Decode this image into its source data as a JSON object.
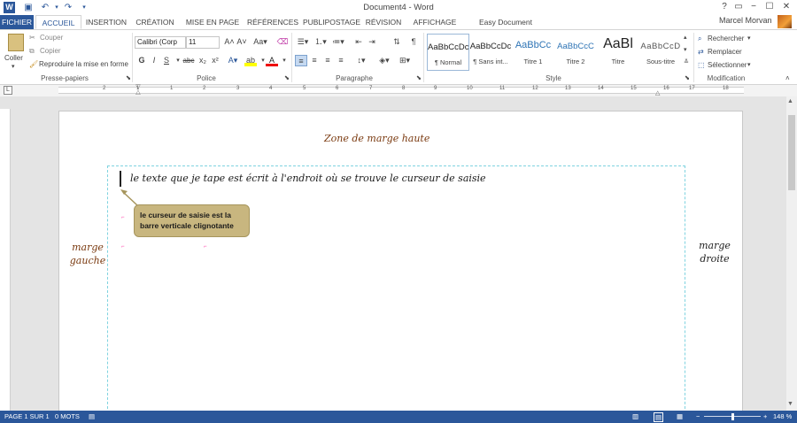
{
  "app": {
    "title": "Document4 - Word",
    "user": "Marcel Morvan",
    "help": "?"
  },
  "tabs": [
    "FICHIER",
    "ACCUEIL",
    "INSERTION",
    "CRÉATION",
    "MISE EN PAGE",
    "RÉFÉRENCES",
    "PUBLIPOSTAGE",
    "RÉVISION",
    "AFFICHAGE",
    "Easy Document Creator"
  ],
  "clipboard": {
    "paste": "Coller",
    "cut": "Couper",
    "copy": "Copier",
    "format_painter": "Reproduire la mise en forme",
    "label": "Presse-papiers"
  },
  "font": {
    "name": "Calibri (Corp",
    "size": "11",
    "bold": "G",
    "italic": "I",
    "underline": "S",
    "strike": "abc",
    "sub": "x₂",
    "sup": "x²",
    "label": "Police"
  },
  "paragraph": {
    "label": "Paragraphe"
  },
  "styles": {
    "label": "Style",
    "items": [
      {
        "preview": "AaBbCcDc",
        "name": "¶ Normal"
      },
      {
        "preview": "AaBbCcDc",
        "name": "¶ Sans int..."
      },
      {
        "preview": "AaBbCc",
        "name": "Titre 1"
      },
      {
        "preview": "AaBbCcC",
        "name": "Titre 2"
      },
      {
        "preview": "AaBl",
        "name": "Titre"
      },
      {
        "preview": "AaBbCcD",
        "name": "Sous-titre"
      }
    ]
  },
  "editing": {
    "find": "Rechercher",
    "replace": "Remplacer",
    "select": "Sélectionner",
    "label": "Modification"
  },
  "ruler_numbers": [
    "2",
    "1",
    "1",
    "2",
    "3",
    "4",
    "5",
    "6",
    "7",
    "8",
    "9",
    "10",
    "11",
    "12",
    "13",
    "14",
    "15",
    "16",
    "17",
    "18"
  ],
  "document": {
    "top_margin": "Zone de marge haute",
    "left_margin_1": "marge",
    "left_margin_2": "gauche",
    "right_margin_1": "marge",
    "right_margin_2": "droite",
    "typed_text": "le texte que je tape est écrit à l'endroit où se trouve le curseur de saisie",
    "bubble": "le curseur de saisie est la barre verticale clignotante"
  },
  "status": {
    "page": "PAGE 1 SUR 1",
    "words": "0 MOTS",
    "zoom": "148 %"
  }
}
